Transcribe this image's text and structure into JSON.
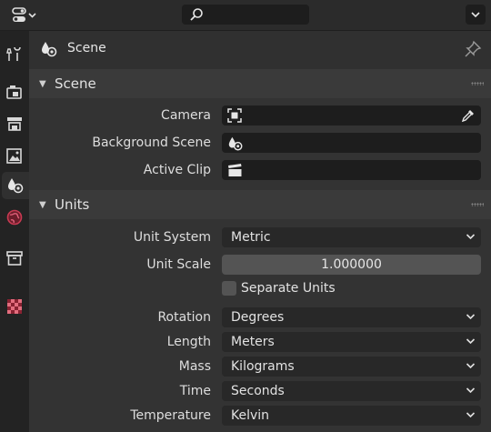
{
  "header": {
    "editor_type_icon": "properties-editor-icon",
    "search_placeholder": "",
    "context_title": "Scene"
  },
  "tabs": [
    {
      "name": "tool",
      "icon": "wrench-screwdriver-icon"
    },
    {
      "name": "render",
      "icon": "camera-back-icon"
    },
    {
      "name": "output",
      "icon": "printer-icon"
    },
    {
      "name": "view-layer",
      "icon": "image-stack-icon"
    },
    {
      "name": "scene",
      "icon": "scene-icon",
      "active": true
    },
    {
      "name": "world",
      "icon": "world-globe-icon"
    },
    {
      "name": "collection",
      "icon": "collection-box-icon"
    },
    {
      "name": "texture",
      "icon": "checker-texture-icon"
    }
  ],
  "scene_panel": {
    "title": "Scene",
    "camera_label": "Camera",
    "background_scene_label": "Background Scene",
    "active_clip_label": "Active Clip"
  },
  "units_panel": {
    "title": "Units",
    "unit_system_label": "Unit System",
    "unit_system_value": "Metric",
    "unit_scale_label": "Unit Scale",
    "unit_scale_value": "1.000000",
    "separate_units_label": "Separate Units",
    "separate_units_checked": false,
    "rotation_label": "Rotation",
    "rotation_value": "Degrees",
    "length_label": "Length",
    "length_value": "Meters",
    "mass_label": "Mass",
    "mass_value": "Kilograms",
    "time_label": "Time",
    "time_value": "Seconds",
    "temperature_label": "Temperature",
    "temperature_value": "Kelvin"
  },
  "colors": {
    "background": "#303030",
    "field": "#1d1d1d",
    "number_field": "#545454",
    "panel_header": "#3a3a3a"
  }
}
